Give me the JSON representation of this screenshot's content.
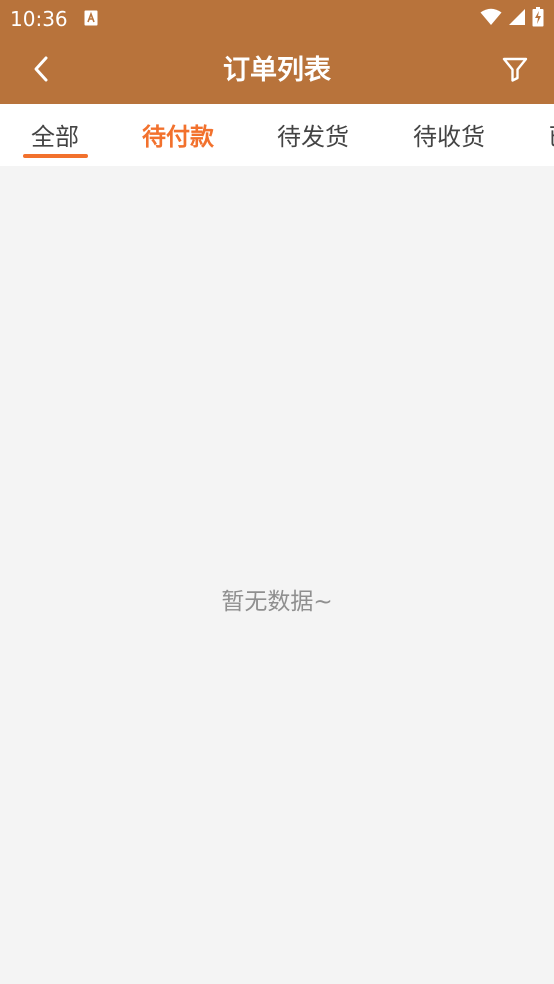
{
  "status_bar": {
    "time": "10:36"
  },
  "header": {
    "title": "订单列表"
  },
  "tabs": [
    {
      "label": "全部"
    },
    {
      "label": "待付款"
    },
    {
      "label": "待发货"
    },
    {
      "label": "待收货"
    },
    {
      "label": "已"
    }
  ],
  "main": {
    "empty_message": "暂无数据~"
  },
  "colors": {
    "header_bg": "#b8733b",
    "accent": "#f2712d",
    "background": "#f4f4f4"
  }
}
